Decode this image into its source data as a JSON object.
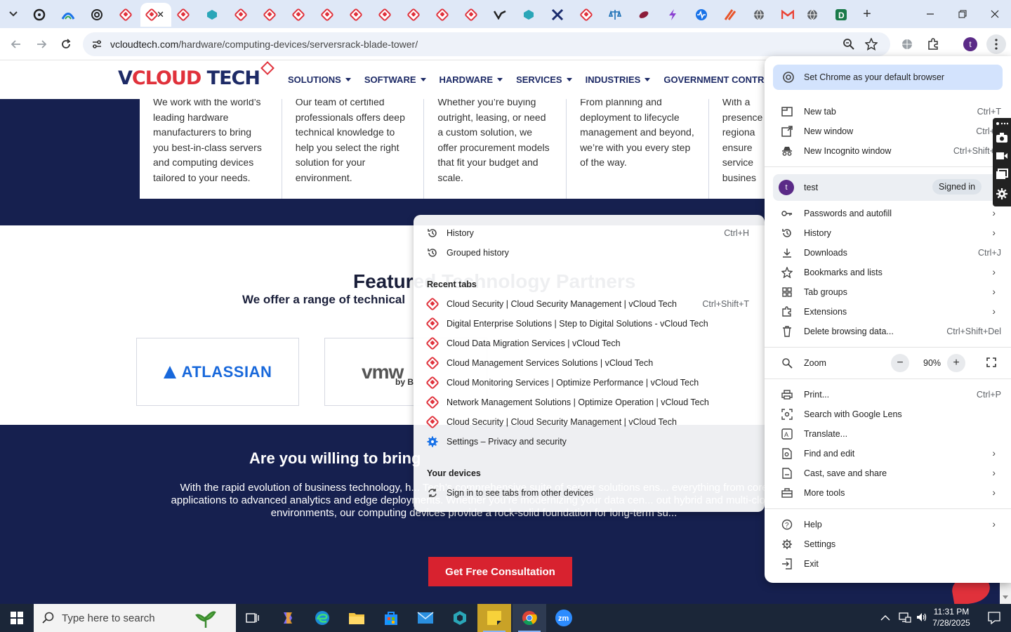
{
  "tabstrip": {
    "active_close": "✕",
    "new_tab": "+",
    "colors": {
      "background": "#dfe8f7",
      "vcloud_red": "#e0313b"
    }
  },
  "toolbar": {
    "url_host": "vcloudtech.com",
    "url_path": "/hardware/computing-devices/serversrack-blade-tower/",
    "profile_initial": "t"
  },
  "site": {
    "logo": {
      "v": "V",
      "cloud": "CLOUD",
      "tech": "TECH"
    },
    "nav": [
      "SOLUTIONS",
      "SOFTWARE",
      "HARDWARE",
      "SERVICES",
      "INDUSTRIES",
      "GOVERNMENT CONTRACTS"
    ],
    "cards": [
      "We work with the world’s leading hardware manufacturers to bring you best-in-class servers and computing devices tailored to your needs.",
      "Our team of certified professionals offers deep technical knowledge to help you select the right solution for your environment.",
      "Whether you’re buying outright, leasing, or need a custom solution, we offer procurement models that fit your budget and scale.",
      "From planning and deployment to lifecycle management and beyond, we’re with you every step of the way.",
      "With a presence regiona ensure service busines"
    ],
    "features_title": "Featured Technology Partners",
    "features_subtitle": "We offer a range of technical",
    "partners": [
      "ATLASSIAN",
      "vmw",
      "by B"
    ],
    "cta_title": "Are you willing to bring",
    "cta_body": "With the rapid evolution of business technology, h... Tech’s comprehensive suite of server solutions ens... everything from core applications to advanced analytics and edge deployments. Whether you’re modernizing your data cen... out hybrid and multi-cloud environments, our computing devices provide a rock-solid foundation for long-term su...",
    "cta_button": "Get Free Consultation"
  },
  "history_menu": {
    "history": {
      "label": "History",
      "shortcut": "Ctrl+H"
    },
    "grouped": {
      "label": "Grouped history"
    },
    "recent_heading": "Recent tabs",
    "recent": [
      {
        "label": "Cloud Security | Cloud Security Management | vCloud Tech",
        "shortcut": "Ctrl+Shift+T"
      },
      {
        "label": "Digital Enterprise Solutions | Step to Digital Solutions - vCloud Tech",
        "shortcut": ""
      },
      {
        "label": "Cloud Data Migration Services | vCloud Tech",
        "shortcut": ""
      },
      {
        "label": "Cloud Management Services  Solutions | vCloud Tech",
        "shortcut": ""
      },
      {
        "label": "Cloud Monitoring Services | Optimize Performance | vCloud Tech",
        "shortcut": ""
      },
      {
        "label": "Network Management Solutions | Optimize Operation | vCloud Tech",
        "shortcut": ""
      },
      {
        "label": "Cloud Security | Cloud Security Management | vCloud Tech",
        "shortcut": ""
      }
    ],
    "settings_item": "Settings – Privacy and security",
    "devices_heading": "Your devices",
    "devices_item": "Sign in to see tabs from other devices"
  },
  "chrome_menu": {
    "default_browser": "Set Chrome as your default browser",
    "new_tab": {
      "label": "New tab",
      "shortcut": "Ctrl+T"
    },
    "new_window": {
      "label": "New window",
      "shortcut": "Ctrl+N"
    },
    "incognito": {
      "label": "New Incognito window",
      "shortcut": "Ctrl+Shift+N"
    },
    "profile": {
      "initial": "t",
      "name": "test",
      "status": "Signed in"
    },
    "passwords": "Passwords and autofill",
    "history": "History",
    "downloads": {
      "label": "Downloads",
      "shortcut": "Ctrl+J"
    },
    "bookmarks": "Bookmarks and lists",
    "tab_groups": "Tab groups",
    "extensions": "Extensions",
    "delete_data": {
      "label": "Delete browsing data...",
      "shortcut": "Ctrl+Shift+Del"
    },
    "zoom": {
      "label": "Zoom",
      "value": "90%",
      "minus": "−",
      "plus": "+"
    },
    "print": {
      "label": "Print...",
      "shortcut": "Ctrl+P"
    },
    "lens": "Search with Google Lens",
    "translate": "Translate...",
    "find_edit": "Find and edit",
    "cast": "Cast, save and share",
    "more_tools": "More tools",
    "help": "Help",
    "settings": "Settings",
    "exit": "Exit"
  },
  "taskbar": {
    "search_placeholder": "Type here to search",
    "time": "11:31 PM",
    "date": "7/28/2025"
  }
}
